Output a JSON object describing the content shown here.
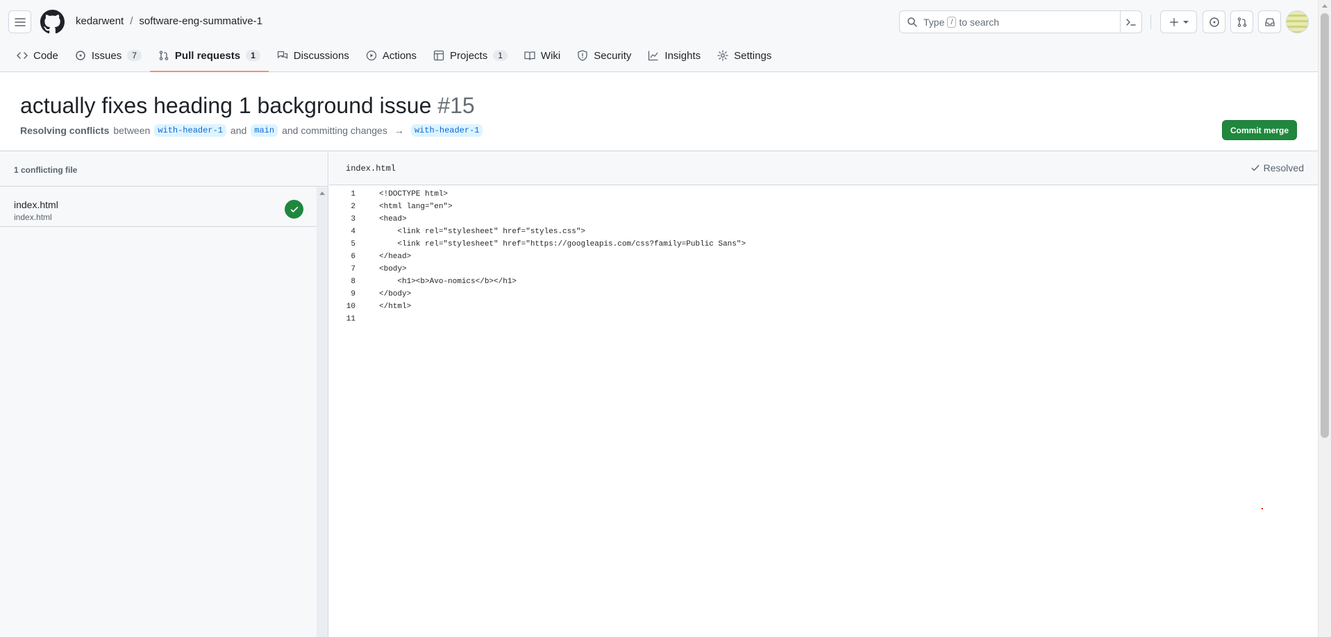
{
  "header": {
    "owner": "kedarwent",
    "separator": "/",
    "repo": "software-eng-summative-1",
    "search": {
      "placeholder_before": "Type",
      "slash_key": "/",
      "placeholder_after": "to search"
    }
  },
  "tabs": [
    {
      "label": "Code",
      "icon": "code-icon"
    },
    {
      "label": "Issues",
      "icon": "issue-opened-icon",
      "count": "7"
    },
    {
      "label": "Pull requests",
      "icon": "git-pull-request-icon",
      "count": "1",
      "selected": true
    },
    {
      "label": "Discussions",
      "icon": "comment-discussion-icon"
    },
    {
      "label": "Actions",
      "icon": "play-icon"
    },
    {
      "label": "Projects",
      "icon": "table-icon",
      "count": "1"
    },
    {
      "label": "Wiki",
      "icon": "book-icon"
    },
    {
      "label": "Security",
      "icon": "shield-icon"
    },
    {
      "label": "Insights",
      "icon": "graph-icon"
    },
    {
      "label": "Settings",
      "icon": "gear-icon"
    }
  ],
  "pr": {
    "title": "actually fixes heading 1 background issue",
    "number": "#15",
    "status_strong": "Resolving conflicts",
    "between": "between",
    "head_branch": "with-header-1",
    "and": "and",
    "base_branch": "main",
    "committing": "and committing changes",
    "arrow": "→",
    "target_branch": "with-header-1",
    "commit_button": "Commit merge"
  },
  "sidebar": {
    "heading": "1 conflicting file",
    "files": [
      {
        "name": "index.html",
        "path": "index.html",
        "resolved": true
      }
    ]
  },
  "editor": {
    "filename": "index.html",
    "status": "Resolved",
    "lines": [
      {
        "n": "1",
        "text": "<!DOCTYPE html>"
      },
      {
        "n": "2",
        "text": "<html lang=\"en\">"
      },
      {
        "n": "3",
        "text": "<head>"
      },
      {
        "n": "4",
        "text": "    <link rel=\"stylesheet\" href=\"styles.css\">"
      },
      {
        "n": "5",
        "text": "    <link rel=\"stylesheet\" href=\"https://googleapis.com/css?family=Public Sans\">"
      },
      {
        "n": "6",
        "text": "</head>"
      },
      {
        "n": "7",
        "text": "<body>"
      },
      {
        "n": "8",
        "text": "    <h1><b>Avo-nomics</b></h1>"
      },
      {
        "n": "9",
        "text": "</body>"
      },
      {
        "n": "10",
        "text": "</html>"
      },
      {
        "n": "11",
        "text": ""
      }
    ]
  },
  "colors": {
    "accent_green": "#1f883d",
    "tab_underline": "#fd8c73",
    "branch_bg": "#ddf4ff",
    "branch_fg": "#0969da"
  }
}
